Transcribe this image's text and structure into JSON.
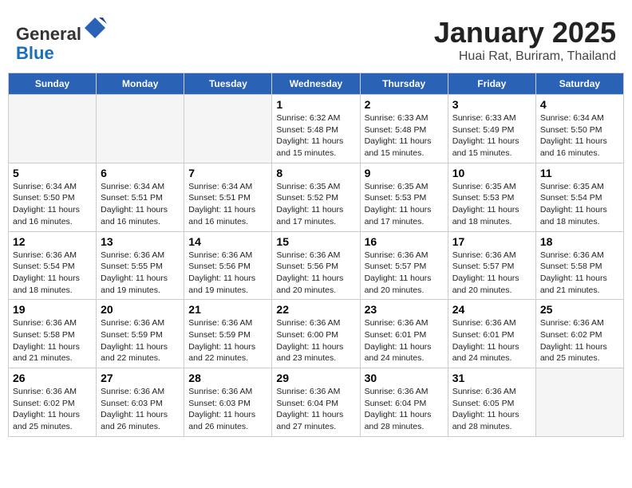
{
  "header": {
    "logo_line1": "General",
    "logo_line2": "Blue",
    "title": "January 2025",
    "subtitle": "Huai Rat, Buriram, Thailand"
  },
  "weekdays": [
    "Sunday",
    "Monday",
    "Tuesday",
    "Wednesday",
    "Thursday",
    "Friday",
    "Saturday"
  ],
  "weeks": [
    [
      {
        "num": "",
        "info": ""
      },
      {
        "num": "",
        "info": ""
      },
      {
        "num": "",
        "info": ""
      },
      {
        "num": "1",
        "info": "Sunrise: 6:32 AM\nSunset: 5:48 PM\nDaylight: 11 hours and 15 minutes."
      },
      {
        "num": "2",
        "info": "Sunrise: 6:33 AM\nSunset: 5:48 PM\nDaylight: 11 hours and 15 minutes."
      },
      {
        "num": "3",
        "info": "Sunrise: 6:33 AM\nSunset: 5:49 PM\nDaylight: 11 hours and 15 minutes."
      },
      {
        "num": "4",
        "info": "Sunrise: 6:34 AM\nSunset: 5:50 PM\nDaylight: 11 hours and 16 minutes."
      }
    ],
    [
      {
        "num": "5",
        "info": "Sunrise: 6:34 AM\nSunset: 5:50 PM\nDaylight: 11 hours and 16 minutes."
      },
      {
        "num": "6",
        "info": "Sunrise: 6:34 AM\nSunset: 5:51 PM\nDaylight: 11 hours and 16 minutes."
      },
      {
        "num": "7",
        "info": "Sunrise: 6:34 AM\nSunset: 5:51 PM\nDaylight: 11 hours and 16 minutes."
      },
      {
        "num": "8",
        "info": "Sunrise: 6:35 AM\nSunset: 5:52 PM\nDaylight: 11 hours and 17 minutes."
      },
      {
        "num": "9",
        "info": "Sunrise: 6:35 AM\nSunset: 5:53 PM\nDaylight: 11 hours and 17 minutes."
      },
      {
        "num": "10",
        "info": "Sunrise: 6:35 AM\nSunset: 5:53 PM\nDaylight: 11 hours and 18 minutes."
      },
      {
        "num": "11",
        "info": "Sunrise: 6:35 AM\nSunset: 5:54 PM\nDaylight: 11 hours and 18 minutes."
      }
    ],
    [
      {
        "num": "12",
        "info": "Sunrise: 6:36 AM\nSunset: 5:54 PM\nDaylight: 11 hours and 18 minutes."
      },
      {
        "num": "13",
        "info": "Sunrise: 6:36 AM\nSunset: 5:55 PM\nDaylight: 11 hours and 19 minutes."
      },
      {
        "num": "14",
        "info": "Sunrise: 6:36 AM\nSunset: 5:56 PM\nDaylight: 11 hours and 19 minutes."
      },
      {
        "num": "15",
        "info": "Sunrise: 6:36 AM\nSunset: 5:56 PM\nDaylight: 11 hours and 20 minutes."
      },
      {
        "num": "16",
        "info": "Sunrise: 6:36 AM\nSunset: 5:57 PM\nDaylight: 11 hours and 20 minutes."
      },
      {
        "num": "17",
        "info": "Sunrise: 6:36 AM\nSunset: 5:57 PM\nDaylight: 11 hours and 20 minutes."
      },
      {
        "num": "18",
        "info": "Sunrise: 6:36 AM\nSunset: 5:58 PM\nDaylight: 11 hours and 21 minutes."
      }
    ],
    [
      {
        "num": "19",
        "info": "Sunrise: 6:36 AM\nSunset: 5:58 PM\nDaylight: 11 hours and 21 minutes."
      },
      {
        "num": "20",
        "info": "Sunrise: 6:36 AM\nSunset: 5:59 PM\nDaylight: 11 hours and 22 minutes."
      },
      {
        "num": "21",
        "info": "Sunrise: 6:36 AM\nSunset: 5:59 PM\nDaylight: 11 hours and 22 minutes."
      },
      {
        "num": "22",
        "info": "Sunrise: 6:36 AM\nSunset: 6:00 PM\nDaylight: 11 hours and 23 minutes."
      },
      {
        "num": "23",
        "info": "Sunrise: 6:36 AM\nSunset: 6:01 PM\nDaylight: 11 hours and 24 minutes."
      },
      {
        "num": "24",
        "info": "Sunrise: 6:36 AM\nSunset: 6:01 PM\nDaylight: 11 hours and 24 minutes."
      },
      {
        "num": "25",
        "info": "Sunrise: 6:36 AM\nSunset: 6:02 PM\nDaylight: 11 hours and 25 minutes."
      }
    ],
    [
      {
        "num": "26",
        "info": "Sunrise: 6:36 AM\nSunset: 6:02 PM\nDaylight: 11 hours and 25 minutes."
      },
      {
        "num": "27",
        "info": "Sunrise: 6:36 AM\nSunset: 6:03 PM\nDaylight: 11 hours and 26 minutes."
      },
      {
        "num": "28",
        "info": "Sunrise: 6:36 AM\nSunset: 6:03 PM\nDaylight: 11 hours and 26 minutes."
      },
      {
        "num": "29",
        "info": "Sunrise: 6:36 AM\nSunset: 6:04 PM\nDaylight: 11 hours and 27 minutes."
      },
      {
        "num": "30",
        "info": "Sunrise: 6:36 AM\nSunset: 6:04 PM\nDaylight: 11 hours and 28 minutes."
      },
      {
        "num": "31",
        "info": "Sunrise: 6:36 AM\nSunset: 6:05 PM\nDaylight: 11 hours and 28 minutes."
      },
      {
        "num": "",
        "info": ""
      }
    ]
  ]
}
